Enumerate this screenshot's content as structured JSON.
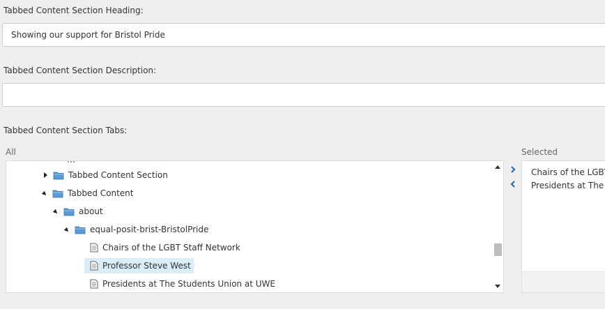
{
  "heading": {
    "label": "Tabbed Content Section Heading:",
    "value": "Showing our support for Bristol Pride"
  },
  "description": {
    "label": "Tabbed Content Section Description:",
    "value": ""
  },
  "tabs": {
    "label": "Tabbed Content Section Tabs:",
    "all_label": "All",
    "selected_label": "Selected",
    "tree": [
      {
        "label": "Tabbed Content Section",
        "type": "folder",
        "state": "collapsed"
      },
      {
        "label": "Tabbed Content",
        "type": "folder",
        "state": "expanded"
      },
      {
        "label": "about",
        "type": "folder",
        "state": "expanded"
      },
      {
        "label": "equal-posit-brist-BristolPride",
        "type": "folder",
        "state": "expanded"
      },
      {
        "label": "Chairs of the LGBT Staff Network",
        "type": "page"
      },
      {
        "label": "Professor Steve West",
        "type": "page",
        "selected": true
      },
      {
        "label": "Presidents at The Students Union at UWE",
        "type": "page"
      }
    ],
    "selected_items": [
      "Chairs of the LGBT",
      "Presidents at The S"
    ],
    "move_right_icon": "chevron-right-icon",
    "move_left_icon": "chevron-left-icon"
  },
  "colors": {
    "background": "#efefef",
    "accent": "#2d6db5",
    "selection": "#d9ecf7",
    "folder": "#5b9bd5"
  }
}
